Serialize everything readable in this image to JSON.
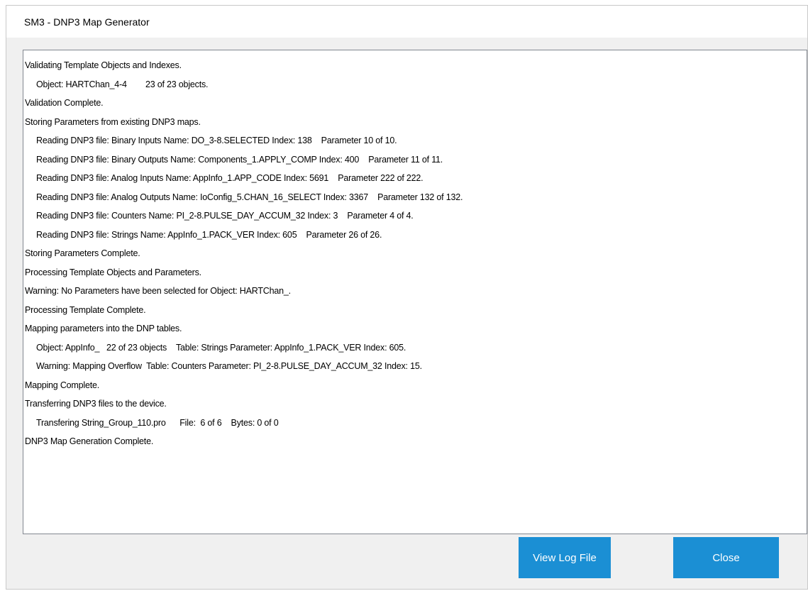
{
  "window": {
    "title": "SM3 - DNP3 Map Generator"
  },
  "log": {
    "lines": [
      {
        "text": "Validating Template Objects and Indexes.",
        "indent": false
      },
      {
        "text": "Object: HARTChan_4-4        23 of 23 objects.",
        "indent": true
      },
      {
        "text": "Validation Complete.",
        "indent": false
      },
      {
        "text": "Storing Parameters from existing DNP3 maps.",
        "indent": false
      },
      {
        "text": "Reading DNP3 file: Binary Inputs Name: DO_3-8.SELECTED Index: 138    Parameter 10 of 10.",
        "indent": true
      },
      {
        "text": "Reading DNP3 file: Binary Outputs Name: Components_1.APPLY_COMP Index: 400    Parameter 11 of 11.",
        "indent": true
      },
      {
        "text": "Reading DNP3 file: Analog Inputs Name: AppInfo_1.APP_CODE Index: 5691    Parameter 222 of 222.",
        "indent": true
      },
      {
        "text": "Reading DNP3 file: Analog Outputs Name: IoConfig_5.CHAN_16_SELECT Index: 3367    Parameter 132 of 132.",
        "indent": true
      },
      {
        "text": "Reading DNP3 file: Counters Name: PI_2-8.PULSE_DAY_ACCUM_32 Index: 3    Parameter 4 of 4.",
        "indent": true
      },
      {
        "text": "Reading DNP3 file: Strings Name: AppInfo_1.PACK_VER Index: 605    Parameter 26 of 26.",
        "indent": true
      },
      {
        "text": "Storing Parameters Complete.",
        "indent": false
      },
      {
        "text": "Processing Template Objects and Parameters.",
        "indent": false
      },
      {
        "text": "Warning: No Parameters have been selected for Object: HARTChan_.",
        "indent": false
      },
      {
        "text": "Processing Template Complete.",
        "indent": false
      },
      {
        "text": "Mapping parameters into the DNP tables.",
        "indent": false
      },
      {
        "text": "Object: AppInfo_   22 of 23 objects    Table: Strings Parameter: AppInfo_1.PACK_VER Index: 605.",
        "indent": true
      },
      {
        "text": "Warning: Mapping Overflow  Table: Counters Parameter: PI_2-8.PULSE_DAY_ACCUM_32 Index: 15.",
        "indent": true
      },
      {
        "text": "Mapping Complete.",
        "indent": false
      },
      {
        "text": "Transferring DNP3 files to the device.",
        "indent": false
      },
      {
        "text": "Transfering String_Group_110.pro      File:  6 of 6    Bytes: 0 of 0",
        "indent": true
      },
      {
        "text": "DNP3 Map Generation Complete.",
        "indent": false
      }
    ]
  },
  "buttons": {
    "view_log": "View Log File",
    "close": "Close"
  },
  "colors": {
    "button_bg": "#1b8fd4",
    "window_bg": "#f0f0f0",
    "log_border": "#828790"
  }
}
